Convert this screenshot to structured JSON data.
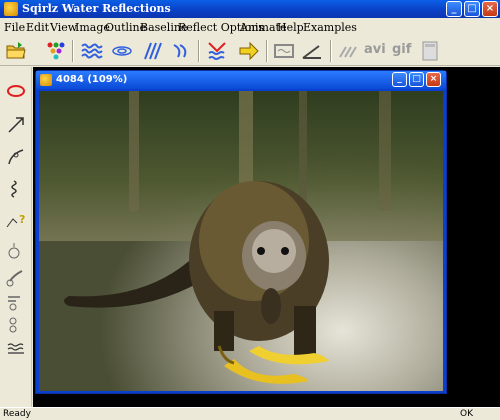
{
  "window": {
    "title": "Sqirlz Water Reflections"
  },
  "menu": [
    "File",
    "Edit",
    "View",
    "Image",
    "Outline",
    "Baseline",
    "Reflect Options",
    "Animate",
    "Help",
    "Examples"
  ],
  "toolbar": {
    "avi_label": "avi",
    "gif_label": "gif"
  },
  "child_window": {
    "title": "4084  (109%)"
  },
  "status": {
    "text": "Ready",
    "ok": "OK"
  },
  "colors": {
    "titlebar": "#0A3FC4",
    "workspace": "#000000",
    "chrome": "#ECE9D8"
  }
}
